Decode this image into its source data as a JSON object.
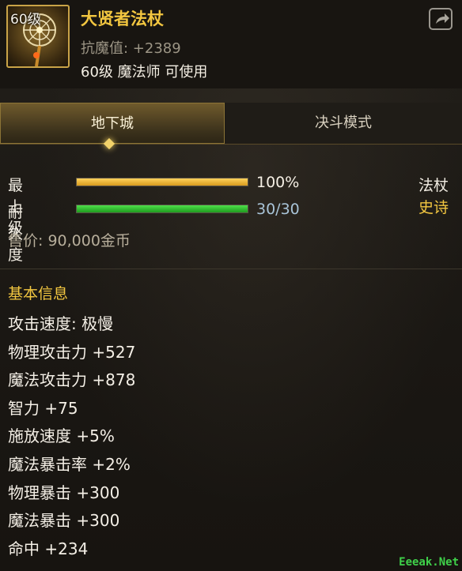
{
  "item": {
    "level_tag": "60级",
    "name": "大贤者法杖",
    "magic_resist": "抗魔值: +2389",
    "requirement": "60级 魔法师 可使用"
  },
  "tabs": [
    {
      "label": "地下城",
      "active": true
    },
    {
      "label": "决斗模式",
      "active": false
    }
  ],
  "upgrade": {
    "label": "最上级",
    "value": "100%",
    "fill_percent": 100
  },
  "durability": {
    "label": "耐久度",
    "value": "30/30",
    "fill_percent": 100
  },
  "item_type": "法杖",
  "rarity": "史诗",
  "price": "售价: 90,000金币",
  "basic_info": {
    "title": "基本信息",
    "stats": [
      "攻击速度: 极慢",
      "物理攻击力 +527",
      "魔法攻击力 +878",
      "智力 +75",
      "施放速度 +5%",
      "魔法暴击率 +2%",
      "物理暴击 +300",
      "魔法暴击 +300",
      "命中 +234"
    ]
  },
  "watermark": "Eeeak.Net",
  "colors": {
    "title_gold": "#f2c640",
    "rarity_gold": "#f2c640",
    "bar_gold": "#ffd25a",
    "bar_green": "#4ee04a"
  }
}
